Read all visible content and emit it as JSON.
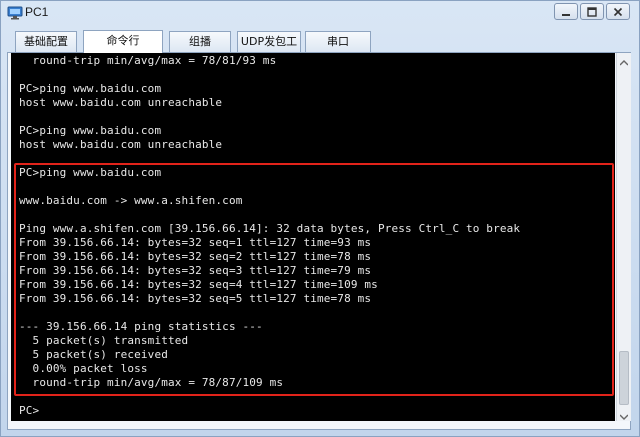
{
  "window": {
    "title": "PC1",
    "controls": {
      "minimize": "minimize-icon",
      "maximize": "maximize-icon",
      "close": "close-icon"
    }
  },
  "tabs": [
    {
      "label": "基础配置",
      "active": false
    },
    {
      "label": "命令行",
      "active": true
    },
    {
      "label": "组播",
      "active": false
    },
    {
      "label": "UDP发包工具",
      "active": false
    },
    {
      "label": "串口",
      "active": false
    }
  ],
  "terminal": {
    "lines": [
      "  round-trip min/avg/max = 78/81/93 ms",
      "",
      "PC>ping www.baidu.com",
      "host www.baidu.com unreachable",
      "",
      "PC>ping www.baidu.com",
      "host www.baidu.com unreachable",
      "",
      "PC>ping www.baidu.com",
      "",
      "www.baidu.com -> www.a.shifen.com",
      "",
      "Ping www.a.shifen.com [39.156.66.14]: 32 data bytes, Press Ctrl_C to break",
      "From 39.156.66.14: bytes=32 seq=1 ttl=127 time=93 ms",
      "From 39.156.66.14: bytes=32 seq=2 ttl=127 time=78 ms",
      "From 39.156.66.14: bytes=32 seq=3 ttl=127 time=79 ms",
      "From 39.156.66.14: bytes=32 seq=4 ttl=127 time=109 ms",
      "From 39.156.66.14: bytes=32 seq=5 ttl=127 time=78 ms",
      "",
      "--- 39.156.66.14 ping statistics ---",
      "  5 packet(s) transmitted",
      "  5 packet(s) received",
      "  0.00% packet loss",
      "  round-trip min/avg/max = 78/87/109 ms",
      "",
      "PC>"
    ]
  },
  "colors": {
    "highlight_border": "#e2231a",
    "terminal_bg": "#000000",
    "terminal_text": "#e8e8e8"
  }
}
